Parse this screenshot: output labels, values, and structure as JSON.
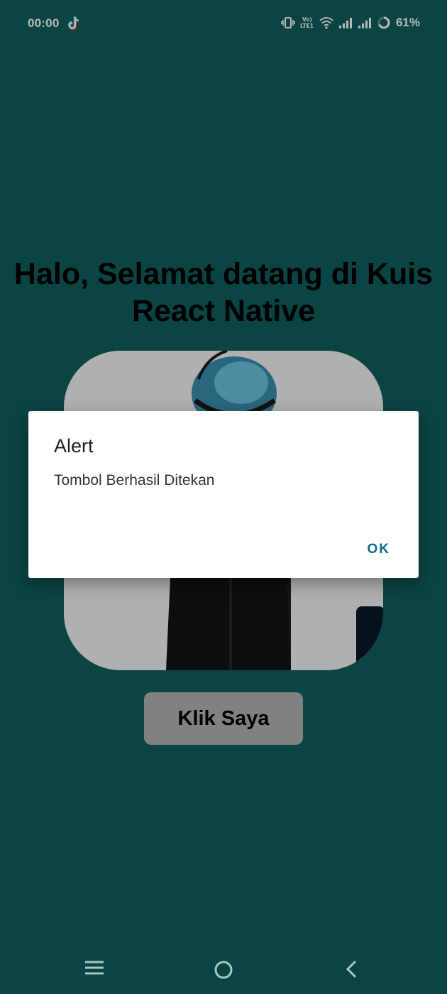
{
  "status": {
    "time": "00:00",
    "network_label": "Vo) LTE1",
    "battery": "61%"
  },
  "icons": {
    "status": [
      "tiktok-icon",
      "vibrate-icon",
      "volte-icon",
      "wifi-icon",
      "signal-icon",
      "signal-icon",
      "battery-ring-icon"
    ],
    "nav": [
      "menu-icon",
      "home-circle-icon",
      "back-chevron-icon"
    ]
  },
  "main": {
    "title_line1": "Halo, Selamat datang di Kuis",
    "title_line2": "React Native",
    "button_label": "Klik Saya"
  },
  "alert": {
    "title": "Alert",
    "message": "Tombol Berhasil Ditekan",
    "ok_label": "OK"
  },
  "colors": {
    "background": "#0e5f5e",
    "button": "#b3b3b3",
    "dialog_action": "#0e6b8a"
  }
}
